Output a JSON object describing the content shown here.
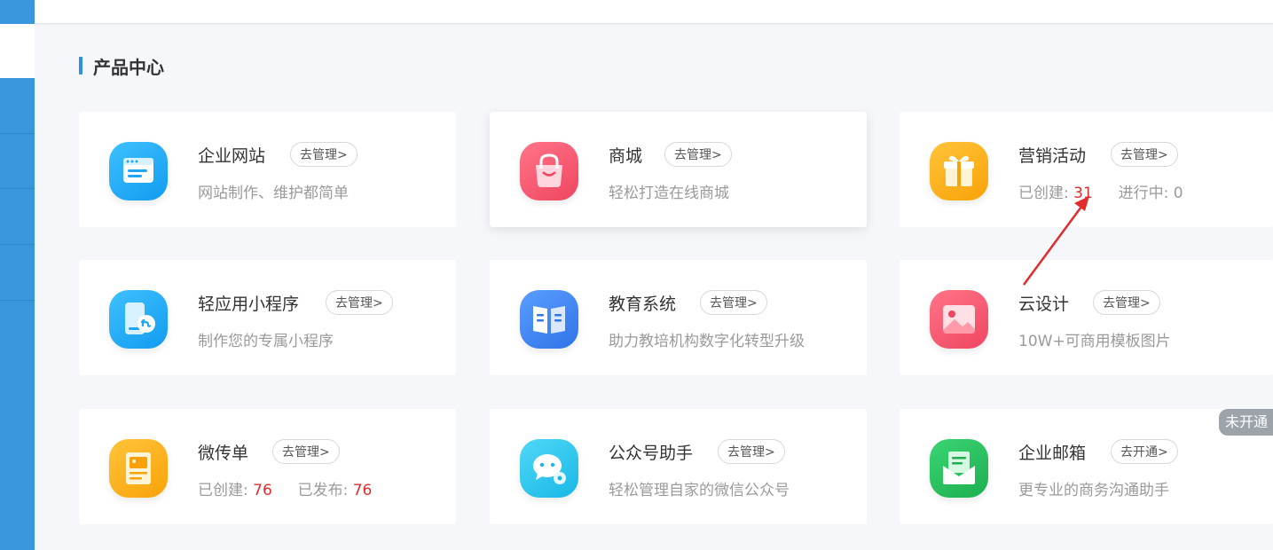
{
  "section": {
    "title": "产品中心"
  },
  "colors": {
    "accent": "#2f8fe0",
    "highlight_number": "#e02c2c",
    "sidebar": "#3a96dd"
  },
  "cards": [
    {
      "name": "企业网站",
      "action": "去管理>",
      "desc": "网站制作、维护都简单",
      "icon": "website-icon",
      "color": "#1ea7f5"
    },
    {
      "name": "商城",
      "action": "去管理>",
      "desc": "轻松打造在线商城",
      "icon": "shopping-bag-icon",
      "color": "#f4546b"
    },
    {
      "name": "营销活动",
      "action": "去管理>",
      "stats": {
        "created_label": "已创建:",
        "created_value": "31",
        "running_label": "进行中:",
        "running_value": "0"
      },
      "icon": "gift-icon",
      "color": "#fbaa11"
    },
    {
      "name": "轻应用小程序",
      "action": "去管理>",
      "desc": "制作您的专属小程序",
      "icon": "mini-program-icon",
      "color": "#1ea7f5"
    },
    {
      "name": "教育系统",
      "action": "去管理>",
      "desc": "助力教培机构数字化转型升级",
      "icon": "book-icon",
      "color": "#3b82ef"
    },
    {
      "name": "云设计",
      "action": "去管理>",
      "desc": "10W+可商用模板图片",
      "icon": "image-icon",
      "color": "#f4546b"
    },
    {
      "name": "微传单",
      "action": "去管理>",
      "stats": {
        "created_label": "已创建:",
        "created_value": "76",
        "published_label": "已发布:",
        "published_value": "76"
      },
      "icon": "flyer-icon",
      "color": "#fbaa11"
    },
    {
      "name": "公众号助手",
      "action": "去管理>",
      "desc": "轻松管理自家的微信公众号",
      "icon": "wechat-icon",
      "color": "#2cc7ee"
    },
    {
      "name": "企业邮箱",
      "action": "去开通>",
      "desc": "更专业的商务沟通助手",
      "icon": "mail-icon",
      "color": "#24c05c"
    }
  ],
  "status_tag": "未开通"
}
